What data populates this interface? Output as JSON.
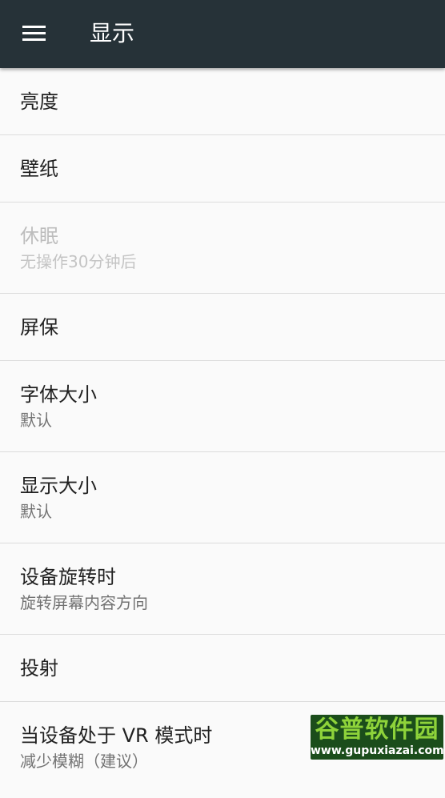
{
  "toolbar": {
    "title": "显示",
    "menu_icon": "hamburger-menu-icon"
  },
  "settings": [
    {
      "title": "亮度"
    },
    {
      "title": "壁纸"
    },
    {
      "title": "休眠",
      "summary": "无操作30分钟后",
      "disabled": true
    },
    {
      "title": "屏保"
    },
    {
      "title": "字体大小",
      "summary": "默认"
    },
    {
      "title": "显示大小",
      "summary": "默认"
    },
    {
      "title": "设备旋转时",
      "summary": "旋转屏幕内容方向"
    },
    {
      "title": "投射"
    },
    {
      "title": "当设备处于 VR 模式时",
      "summary": "减少模糊（建议）"
    }
  ],
  "watermark": {
    "main": "谷普软件园",
    "url": "www.gupuxiazai.com"
  },
  "colors": {
    "toolbar": "#263238",
    "background": "#fafafa",
    "title_text": "#212121",
    "summary_text": "#737373",
    "disabled_text": "#bdbdbd"
  }
}
